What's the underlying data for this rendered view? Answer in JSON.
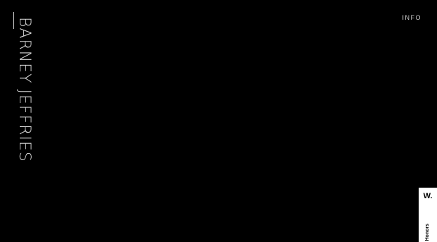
{
  "header": {
    "site_title": "BARNEY JEFFRIES",
    "info_link": "INFO"
  },
  "badge": {
    "logo": "W.",
    "label": "Honors"
  },
  "colors": {
    "background": "#000000",
    "text": "#d8d8d8",
    "badge_background": "#ffffff"
  }
}
